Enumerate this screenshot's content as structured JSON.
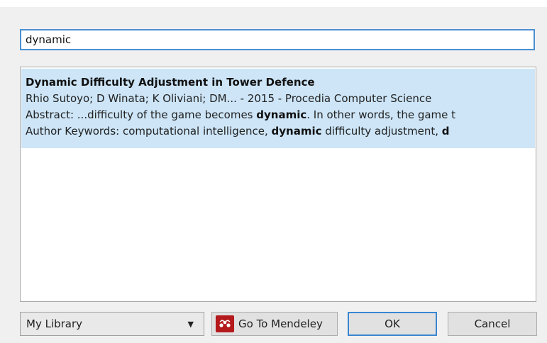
{
  "search": {
    "value": "dynamic"
  },
  "results": [
    {
      "title": "Dynamic Difficulty Adjustment in Tower Defence",
      "meta": "Rhio Sutoyo; D Winata; K Oliviani; DM... - 2015 - Procedia Computer Science",
      "abstract_prefix": "Abstract: ...difficulty of the game becomes ",
      "abstract_bold": "dynamic",
      "abstract_suffix": ". In other words, the game t",
      "keywords_prefix": "Author Keywords: computational intelligence, ",
      "keywords_bold": "dynamic",
      "keywords_suffix": " difficulty adjustment, ",
      "keywords_trailing_bold": "d"
    }
  ],
  "footer": {
    "library_selected": "My Library",
    "mendeley_label": "Go To Mendeley",
    "ok_label": "OK",
    "cancel_label": "Cancel"
  },
  "icons": {
    "mendeley": "mendeley-logo-icon",
    "dropdown": "chevron-down-icon"
  },
  "colors": {
    "selection": "#cde5f7",
    "focus_border": "#4b8fd1",
    "mendeley_red": "#b4191c"
  }
}
